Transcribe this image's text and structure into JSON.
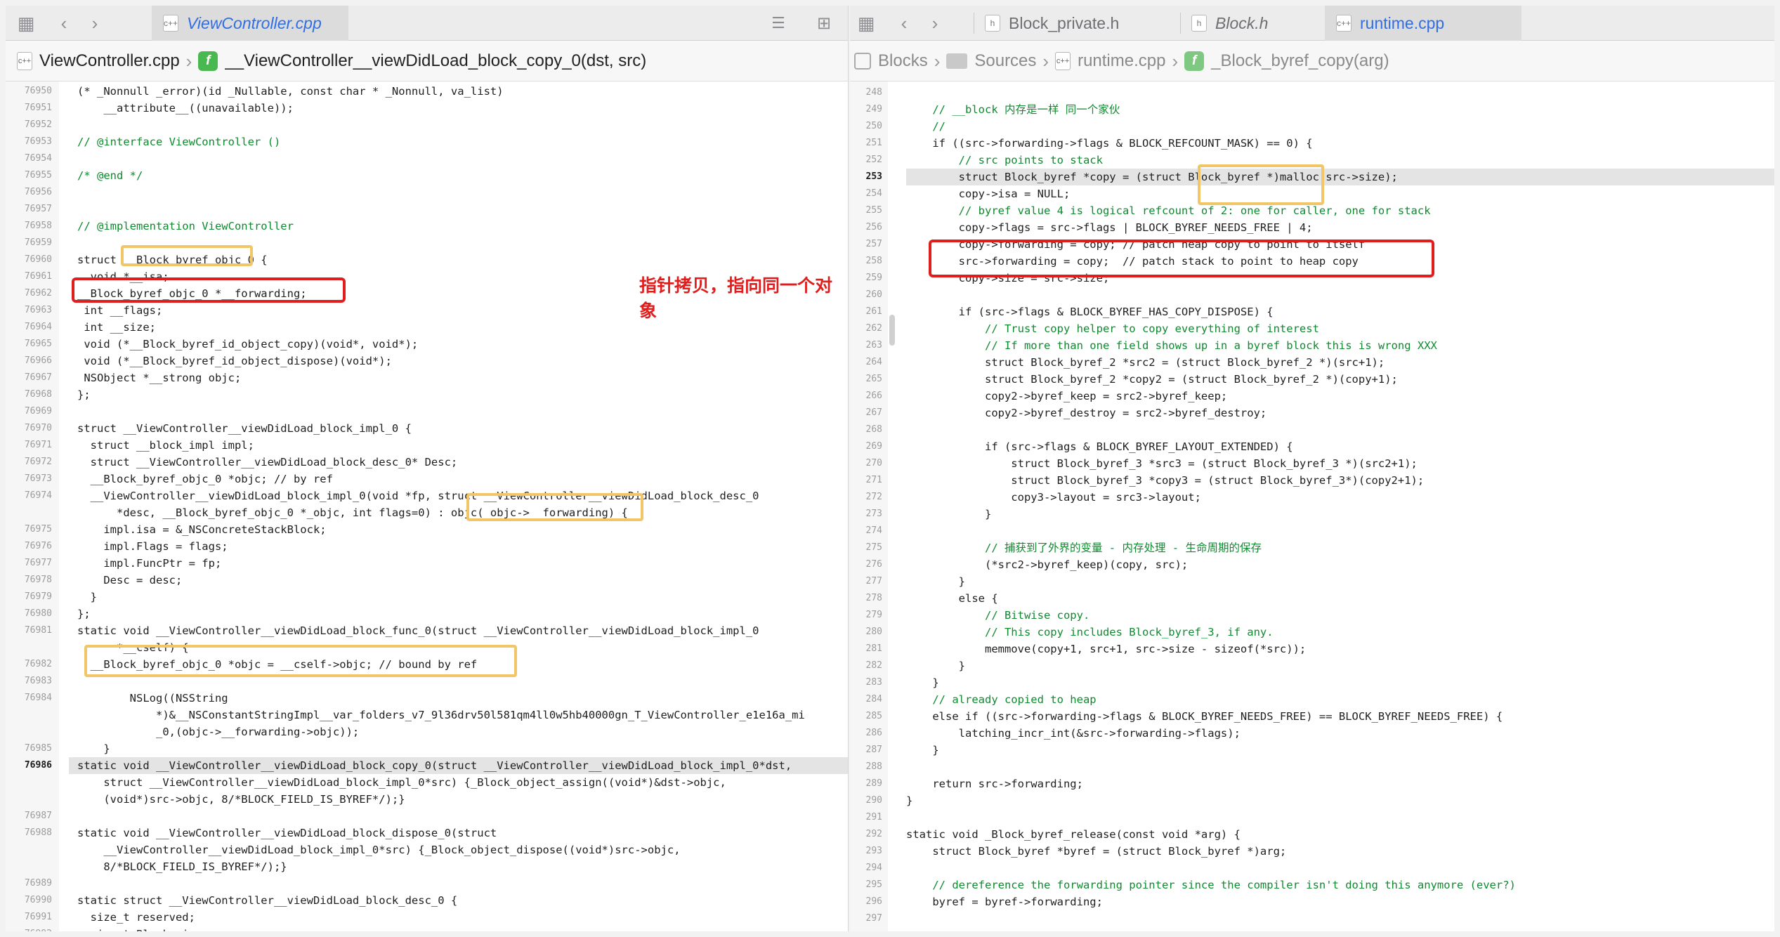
{
  "left": {
    "tab": {
      "label": "ViewController.cpp",
      "icon": "cpp-file-icon"
    },
    "breadcrumb": [
      {
        "label": "ViewController.cpp",
        "icon": "cpp-file-icon"
      },
      {
        "label": "__ViewController__viewDidLoad_block_copy_0(dst, src)",
        "icon": "function-icon"
      }
    ],
    "current_line": "76986",
    "lines": [
      {
        "n": "76950",
        "t": "(* _Nonnull _error)(id _Nullable, const char * _Nonnull, va_list)"
      },
      {
        "n": "76951",
        "t": "    __attribute__((unavailable));"
      },
      {
        "n": "76952",
        "t": ""
      },
      {
        "n": "76953",
        "t": "// @interface ViewController ()",
        "c": "cm"
      },
      {
        "n": "76954",
        "t": ""
      },
      {
        "n": "76955",
        "t": "/* @end */",
        "c": "cm"
      },
      {
        "n": "76956",
        "t": ""
      },
      {
        "n": "76957",
        "t": ""
      },
      {
        "n": "76958",
        "t": "// @implementation ViewController",
        "c": "cm"
      },
      {
        "n": "76959",
        "t": ""
      },
      {
        "n": "76960",
        "t": "struct __Block_byref_objc_0 {"
      },
      {
        "n": "76961",
        "t": "  void *__isa;"
      },
      {
        "n": "76962",
        "t": "__Block_byref_objc_0 *__forwarding;"
      },
      {
        "n": "76963",
        "t": " int __flags;"
      },
      {
        "n": "76964",
        "t": " int __size;"
      },
      {
        "n": "76965",
        "t": " void (*__Block_byref_id_object_copy)(void*, void*);"
      },
      {
        "n": "76966",
        "t": " void (*__Block_byref_id_object_dispose)(void*);"
      },
      {
        "n": "76967",
        "t": " NSObject *__strong objc;"
      },
      {
        "n": "76968",
        "t": "};"
      },
      {
        "n": "76969",
        "t": ""
      },
      {
        "n": "76970",
        "t": "struct __ViewController__viewDidLoad_block_impl_0 {"
      },
      {
        "n": "76971",
        "t": "  struct __block_impl impl;"
      },
      {
        "n": "76972",
        "t": "  struct __ViewController__viewDidLoad_block_desc_0* Desc;"
      },
      {
        "n": "76973",
        "t": "  __Block_byref_objc_0 *objc; // by ref"
      },
      {
        "n": "76974",
        "t": "  __ViewController__viewDidLoad_block_impl_0(void *fp, struct __ViewController__viewDidLoad_block_desc_0"
      },
      {
        "n": "",
        "t": "      *desc, __Block_byref_objc_0 *_objc, int flags=0) : objc(_objc->__forwarding) {"
      },
      {
        "n": "76975",
        "t": "    impl.isa = &_NSConcreteStackBlock;"
      },
      {
        "n": "76976",
        "t": "    impl.Flags = flags;"
      },
      {
        "n": "76977",
        "t": "    impl.FuncPtr = fp;"
      },
      {
        "n": "76978",
        "t": "    Desc = desc;"
      },
      {
        "n": "76979",
        "t": "  }"
      },
      {
        "n": "76980",
        "t": "};"
      },
      {
        "n": "76981",
        "t": "static void __ViewController__viewDidLoad_block_func_0(struct __ViewController__viewDidLoad_block_impl_0"
      },
      {
        "n": "",
        "t": "      *__cself) {"
      },
      {
        "n": "76982",
        "t": "  __Block_byref_objc_0 *objc = __cself->objc; // bound by ref"
      },
      {
        "n": "76983",
        "t": ""
      },
      {
        "n": "76984",
        "t": "        NSLog((NSString"
      },
      {
        "n": "",
        "t": "            *)&__NSConstantStringImpl__var_folders_v7_9l36drv50l581qm4ll0w5hb40000gn_T_ViewController_e1e16a_mi"
      },
      {
        "n": "",
        "t": "            _0,(objc->__forwarding->objc));"
      },
      {
        "n": "76985",
        "t": "    }"
      },
      {
        "n": "76986",
        "t": "static void __ViewController__viewDidLoad_block_copy_0(struct __ViewController__viewDidLoad_block_impl_0*dst,"
      },
      {
        "n": "",
        "t": "    struct __ViewController__viewDidLoad_block_impl_0*src) {_Block_object_assign((void*)&dst->objc,"
      },
      {
        "n": "",
        "t": "    (void*)src->objc, 8/*BLOCK_FIELD_IS_BYREF*/);}"
      },
      {
        "n": "76987",
        "t": ""
      },
      {
        "n": "76988",
        "t": "static void __ViewController__viewDidLoad_block_dispose_0(struct"
      },
      {
        "n": "",
        "t": "    __ViewController__viewDidLoad_block_impl_0*src) {_Block_object_dispose((void*)src->objc,"
      },
      {
        "n": "",
        "t": "    8/*BLOCK_FIELD_IS_BYREF*/);}"
      },
      {
        "n": "76989",
        "t": ""
      },
      {
        "n": "76990",
        "t": "static struct __ViewController__viewDidLoad_block_desc_0 {"
      },
      {
        "n": "76991",
        "t": "  size_t reserved;"
      },
      {
        "n": "76992",
        "t": "  size_t Block_size;"
      }
    ]
  },
  "annotation": {
    "text": "指针拷贝，指向同一个对象",
    "color": "#e01e1e"
  },
  "right": {
    "tabs": [
      {
        "label": "Block_private.h",
        "icon": "header-file-icon",
        "active": false
      },
      {
        "label": "Block.h",
        "icon": "header-file-icon",
        "active": false,
        "italic": true
      },
      {
        "label": "runtime.cpp",
        "icon": "cpp-file-icon",
        "active": true
      }
    ],
    "breadcrumb": [
      {
        "label": "Blocks",
        "icon": "blocks-project-icon"
      },
      {
        "label": "Sources",
        "icon": "folder-icon"
      },
      {
        "label": "runtime.cpp",
        "icon": "cpp-file-icon"
      },
      {
        "label": "_Block_byref_copy(arg)",
        "icon": "function-icon"
      }
    ],
    "current_line": "253",
    "lines": [
      {
        "n": "248",
        "t": ""
      },
      {
        "n": "249",
        "t": "    // __block 内存是一样 同一个家伙",
        "c": "cm"
      },
      {
        "n": "250",
        "t": "    //",
        "c": "cm"
      },
      {
        "n": "251",
        "t": "    if ((src->forwarding->flags & BLOCK_REFCOUNT_MASK) == 0) {"
      },
      {
        "n": "252",
        "t": "        // src points to stack",
        "c": "cm"
      },
      {
        "n": "253",
        "t": "        struct Block_byref *copy = (struct Block_byref *)malloc(src->size);"
      },
      {
        "n": "254",
        "t": "        copy->isa = NULL;"
      },
      {
        "n": "255",
        "t": "        // byref value 4 is logical refcount of 2: one for caller, one for stack",
        "c": "cm"
      },
      {
        "n": "256",
        "t": "        copy->flags = src->flags | BLOCK_BYREF_NEEDS_FREE | 4;"
      },
      {
        "n": "257",
        "t": "        copy->forwarding = copy; // patch heap copy to point to itself"
      },
      {
        "n": "258",
        "t": "        src->forwarding = copy;  // patch stack to point to heap copy"
      },
      {
        "n": "259",
        "t": "        copy->size = src->size;"
      },
      {
        "n": "260",
        "t": ""
      },
      {
        "n": "261",
        "t": "        if (src->flags & BLOCK_BYREF_HAS_COPY_DISPOSE) {"
      },
      {
        "n": "262",
        "t": "            // Trust copy helper to copy everything of interest",
        "c": "cm"
      },
      {
        "n": "263",
        "t": "            // If more than one field shows up in a byref block this is wrong XXX",
        "c": "cm"
      },
      {
        "n": "264",
        "t": "            struct Block_byref_2 *src2 = (struct Block_byref_2 *)(src+1);"
      },
      {
        "n": "265",
        "t": "            struct Block_byref_2 *copy2 = (struct Block_byref_2 *)(copy+1);"
      },
      {
        "n": "266",
        "t": "            copy2->byref_keep = src2->byref_keep;"
      },
      {
        "n": "267",
        "t": "            copy2->byref_destroy = src2->byref_destroy;"
      },
      {
        "n": "268",
        "t": ""
      },
      {
        "n": "269",
        "t": "            if (src->flags & BLOCK_BYREF_LAYOUT_EXTENDED) {"
      },
      {
        "n": "270",
        "t": "                struct Block_byref_3 *src3 = (struct Block_byref_3 *)(src2+1);"
      },
      {
        "n": "271",
        "t": "                struct Block_byref_3 *copy3 = (struct Block_byref_3*)(copy2+1);"
      },
      {
        "n": "272",
        "t": "                copy3->layout = src3->layout;"
      },
      {
        "n": "273",
        "t": "            }"
      },
      {
        "n": "274",
        "t": ""
      },
      {
        "n": "275",
        "t": "            // 捕获到了外界的变量 - 内存处理 - 生命周期的保存",
        "c": "cm"
      },
      {
        "n": "276",
        "t": "            (*src2->byref_keep)(copy, src);"
      },
      {
        "n": "277",
        "t": "        }"
      },
      {
        "n": "278",
        "t": "        else {"
      },
      {
        "n": "279",
        "t": "            // Bitwise copy.",
        "c": "cm"
      },
      {
        "n": "280",
        "t": "            // This copy includes Block_byref_3, if any.",
        "c": "cm"
      },
      {
        "n": "281",
        "t": "            memmove(copy+1, src+1, src->size - sizeof(*src));"
      },
      {
        "n": "282",
        "t": "        }"
      },
      {
        "n": "283",
        "t": "    }"
      },
      {
        "n": "284",
        "t": "    // already copied to heap",
        "c": "cm"
      },
      {
        "n": "285",
        "t": "    else if ((src->forwarding->flags & BLOCK_BYREF_NEEDS_FREE) == BLOCK_BYREF_NEEDS_FREE) {"
      },
      {
        "n": "286",
        "t": "        latching_incr_int(&src->forwarding->flags);"
      },
      {
        "n": "287",
        "t": "    }"
      },
      {
        "n": "288",
        "t": ""
      },
      {
        "n": "289",
        "t": "    return src->forwarding;"
      },
      {
        "n": "290",
        "t": "}"
      },
      {
        "n": "291",
        "t": ""
      },
      {
        "n": "292",
        "t": "static void _Block_byref_release(const void *arg) {"
      },
      {
        "n": "293",
        "t": "    struct Block_byref *byref = (struct Block_byref *)arg;"
      },
      {
        "n": "294",
        "t": ""
      },
      {
        "n": "295",
        "t": "    // dereference the forwarding pointer since the compiler isn't doing this anymore (ever?)",
        "c": "cm"
      },
      {
        "n": "296",
        "t": "    byref = byref->forwarding;"
      },
      {
        "n": "297",
        "t": ""
      }
    ]
  },
  "colors": {
    "highlight_yellow": "#f1c667",
    "highlight_red": "#e01e1e",
    "active_tab": "#2f6ee6"
  },
  "icons": [
    "related-items-icon",
    "back-chevron-icon",
    "forward-chevron-icon",
    "editor-options-icon",
    "add-editor-icon"
  ]
}
